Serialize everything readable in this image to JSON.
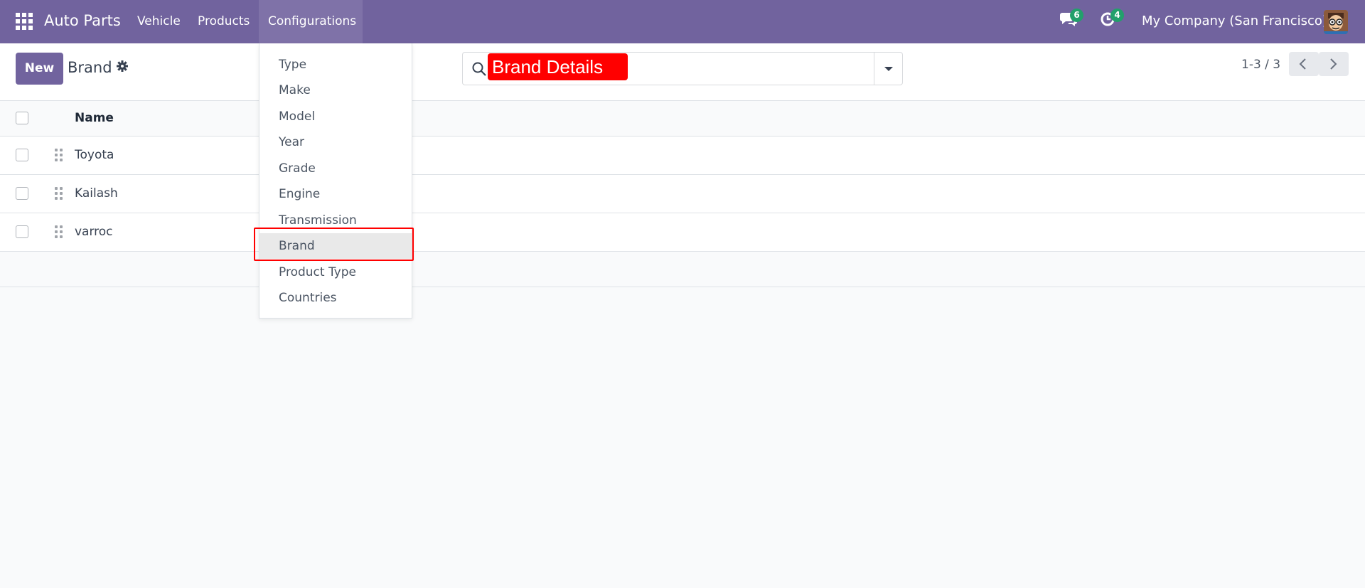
{
  "navbar": {
    "app_title": "Auto Parts",
    "menu": [
      "Vehicle",
      "Products",
      "Configurations"
    ],
    "messages_count": "6",
    "activities_count": "4",
    "company": "My Company (San Francisco)"
  },
  "control_panel": {
    "new_label": "New",
    "title": "Brand",
    "search_value": "",
    "pager": "1-3 / 3"
  },
  "annotation": "Brand Details",
  "list": {
    "header_name": "Name",
    "rows": [
      "Toyota",
      "Kailash",
      "varroc"
    ]
  },
  "dropdown": {
    "items": [
      "Type",
      "Make",
      "Model",
      "Year",
      "Grade",
      "Engine",
      "Transmission",
      "Brand",
      "Product Type",
      "Countries"
    ],
    "selected": "Brand"
  },
  "colors": {
    "navbar": "#71639e",
    "accent": "#71639e",
    "badge": "#22a06b",
    "annotation": "#ff0000"
  }
}
